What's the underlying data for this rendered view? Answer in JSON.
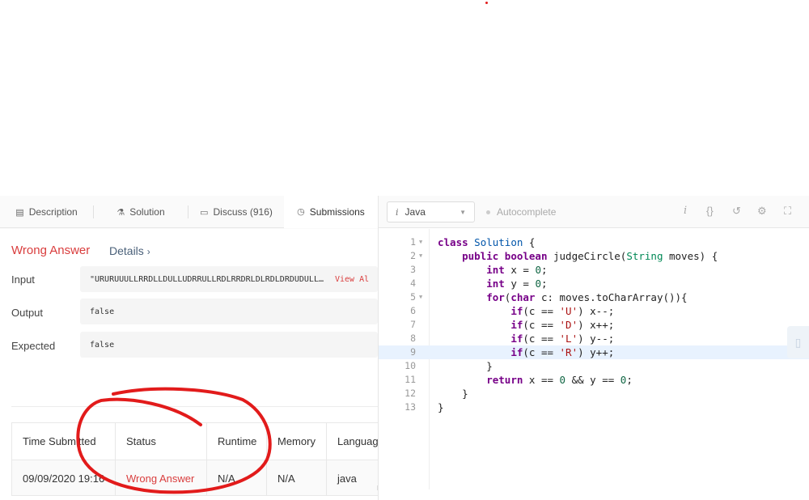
{
  "tabs": [
    {
      "icon": "description-icon",
      "label": "Description"
    },
    {
      "icon": "flask-icon",
      "label": "Solution"
    },
    {
      "icon": "comment-icon",
      "label": "Discuss (916)"
    },
    {
      "icon": "clock-icon",
      "label": "Submissions"
    }
  ],
  "result": {
    "title": "Wrong Answer",
    "details_label": "Details",
    "input_label": "Input",
    "input_value": "\"URURUUULLRRDLLDULLUDRRULLRDLRRDRLDLRDLDRDUDULL…",
    "view_all_label": "View Al",
    "output_label": "Output",
    "output_value": "false",
    "expected_label": "Expected",
    "expected_value": "false"
  },
  "table": {
    "headers": [
      "Time Submitted",
      "Status",
      "Runtime",
      "Memory",
      "Languag"
    ],
    "rows": [
      [
        "09/09/2020 19:16",
        "Wrong Answer",
        "N/A",
        "N/A",
        "java"
      ]
    ]
  },
  "editor": {
    "language": "Java",
    "autocomplete_label": "Autocomplete",
    "line_numbers": [
      "1",
      "2",
      "3",
      "4",
      "5",
      "6",
      "7",
      "8",
      "9",
      "10",
      "11",
      "12",
      "13"
    ],
    "highlight_line": 9,
    "code_lines": [
      "class Solution {",
      "    public boolean judgeCircle(String moves) {",
      "        int x = 0;",
      "        int y = 0;",
      "        for(char c: moves.toCharArray()){",
      "            if(c == 'U') x--;",
      "            if(c == 'D') x++;",
      "            if(c == 'L') y--;",
      "            if(c == 'R') y++;",
      "        }",
      "        return x == 0 && y == 0;",
      "    }",
      "}"
    ]
  },
  "icons": {
    "toolbar": [
      "info-icon",
      "braces-icon",
      "reset-icon",
      "settings-icon",
      "fullscreen-icon"
    ]
  },
  "colors": {
    "error_red": "#d93d3d",
    "annotation_red": "#e21b1b",
    "line_highlight": "#e8f2fe"
  }
}
